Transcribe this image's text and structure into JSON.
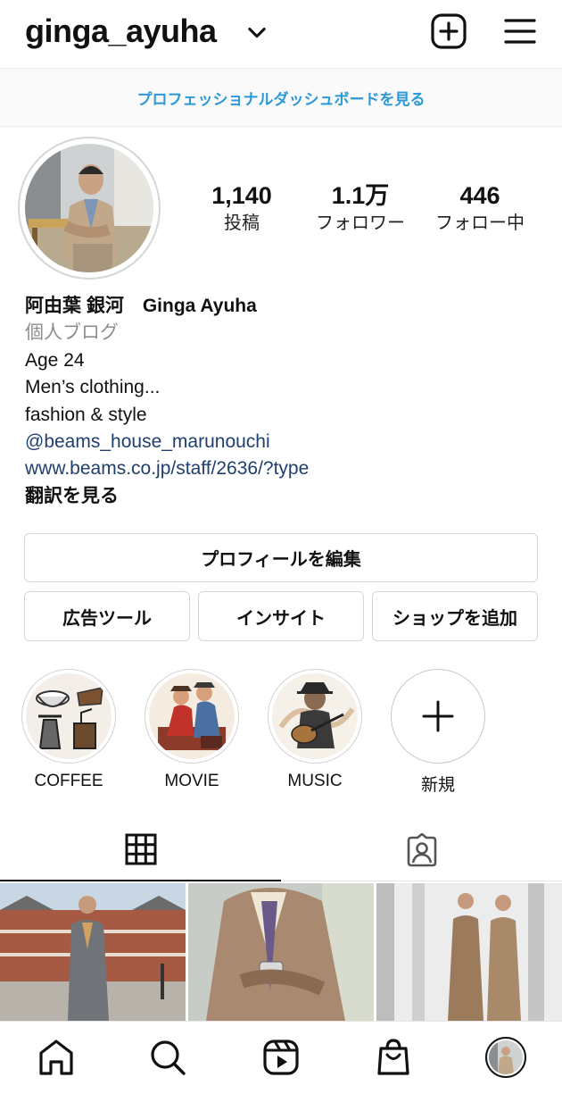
{
  "header": {
    "username": "ginga_ayuha",
    "icons": {
      "account_switch": "chevron-down-icon",
      "new_post": "plus-square-icon",
      "menu": "hamburger-menu-icon"
    }
  },
  "dashboard": {
    "label": "プロフェッショナルダッシュボードを見る"
  },
  "stats": {
    "posts": {
      "value": "1,140",
      "label": "投稿"
    },
    "followers": {
      "value": "1.1万",
      "label": "フォロワー"
    },
    "following": {
      "value": "446",
      "label": "フォロー中"
    }
  },
  "bio": {
    "name": "阿由葉 銀河　Ginga Ayuha",
    "category": "個人ブログ",
    "lines": [
      "Age 24",
      "Men’s clothing...",
      "fashion & style"
    ],
    "mention": "@beams_house_marunouchi",
    "website": "www.beams.co.jp/staff/2636/?type",
    "translate": "翻訳を見る"
  },
  "buttons": {
    "edit_profile": "プロフィールを編集",
    "ad_tools": "広告ツール",
    "insights": "インサイト",
    "add_shop": "ショップを追加"
  },
  "highlights": [
    {
      "label": "COFFEE"
    },
    {
      "label": "MOVIE"
    },
    {
      "label": "MUSIC"
    },
    {
      "label": "新規"
    }
  ],
  "tabs": {
    "grid": "grid-icon",
    "tagged": "tagged-person-icon",
    "active": "grid"
  },
  "nav": {
    "items": [
      "home-icon",
      "search-icon",
      "reels-icon",
      "shop-bag-icon",
      "profile-avatar"
    ]
  },
  "colors": {
    "link_blue": "#2d98d6",
    "mention_blue": "#1f3f6e",
    "muted": "#8e8e8e",
    "border": "#d5d5d5"
  }
}
